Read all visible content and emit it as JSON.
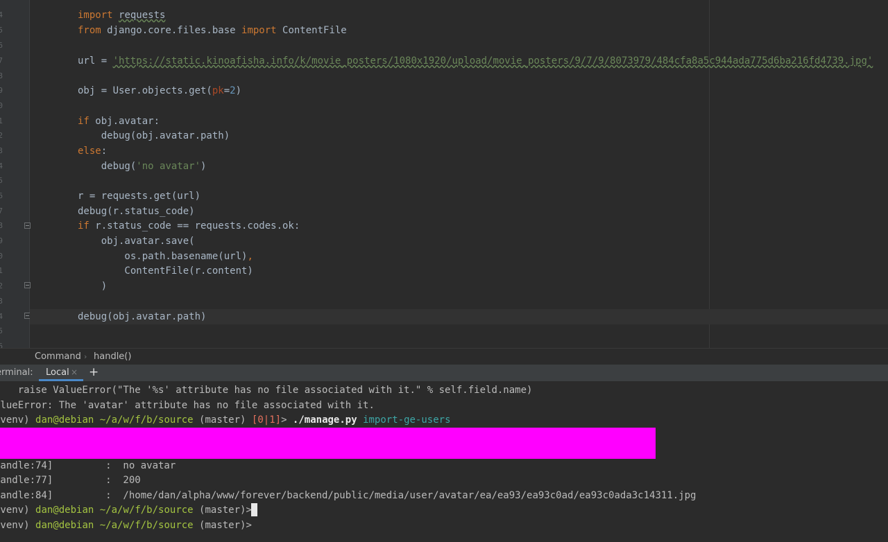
{
  "editor": {
    "line_numbers": [
      "4",
      "5",
      "6",
      "7",
      "8",
      "9",
      "0",
      "1",
      "2",
      "3",
      "4",
      "5",
      "6",
      "7",
      "8",
      "9",
      "0",
      "1",
      "2",
      "3",
      "4",
      "5",
      "6"
    ],
    "lines": {
      "l1_kw": "import",
      "l1_mod": "requests",
      "l2_from": "from",
      "l2_mod": " django.core.files.base ",
      "l2_import": "import",
      "l2_name": " ContentFile",
      "l4_var": "url = ",
      "l4_str": "'https://static.kinoafisha.info/k/movie_posters/1080x1920/upload/movie_posters/9/7/9/8073979/484cfa8a5c944ada775d6ba216fd4739.jpg'",
      "l6_a": "obj = User.objects.get(",
      "l6_param": "pk",
      "l6_eq": "=",
      "l6_num": "2",
      "l6_close": ")",
      "l8_kw": "if",
      "l8_rest": " obj.avatar:",
      "l9": "    debug(obj.avatar.path)",
      "l10_kw": "else",
      "l10_rest": ":",
      "l11_a": "    debug(",
      "l11_str": "'no avatar'",
      "l11_close": ")",
      "l13": "r = requests.get(url)",
      "l14": "debug(r.status_code)",
      "l15_kw": "if",
      "l15_rest": " r.status_code == requests.codes.ok:",
      "l16": "    obj.avatar.save(",
      "l17_a": "        os.path.basename(url)",
      "l17_comma": ",",
      "l18": "        ContentFile(r.content)",
      "l19": "    )",
      "l21": "debug(obj.avatar.path)"
    }
  },
  "breadcrumb": {
    "item1": "Command",
    "separator": "›",
    "item2": "handle()"
  },
  "terminal": {
    "label": "erminal:",
    "tab_local": "Local",
    "tab_close": "×",
    "add": "+",
    "lines": {
      "t1": "    raise ValueError(\"The '%s' attribute has no file associated with it.\" % self.field.name)",
      "t2": "alueError: The 'avatar' attribute has no file associated with it.",
      "p1_env": ".venv) ",
      "p1_user": "dan@debian",
      "p1_path": " ~/a/w/f/b/source",
      "p1_branch": " (master) ",
      "p1_status": "[0|1]",
      "p1_gt": "> ",
      "p1_cmd": "./manage.py",
      "p1_arg": " import-ge-users",
      "t3": "handle:74]         :  no avatar",
      "t4": "handle:77]         :  200",
      "t5": "handle:84]         :  /home/dan/alpha/www/forever/backend/public/media/user/avatar/ea/ea93/ea93c0ad/ea93c0ada3c14311.jpg",
      "p2_env": ".venv) ",
      "p2_user": "dan@debian",
      "p2_path": " ~/a/w/f/b/source",
      "p2_branch": " (master)>",
      "p3_env": ".venv) ",
      "p3_user": "dan@debian",
      "p3_path": " ~/a/w/f/b/source",
      "p3_branch": " (master)>"
    }
  },
  "colors": {
    "editor_bg": "#2b2b2b",
    "keyword": "#cc7832",
    "string": "#6a8759",
    "number": "#6897bb",
    "redaction": "#ff00ff",
    "prompt_user": "#a4c441",
    "prompt_status": "#e3705d",
    "arg": "#3ea6a6"
  }
}
